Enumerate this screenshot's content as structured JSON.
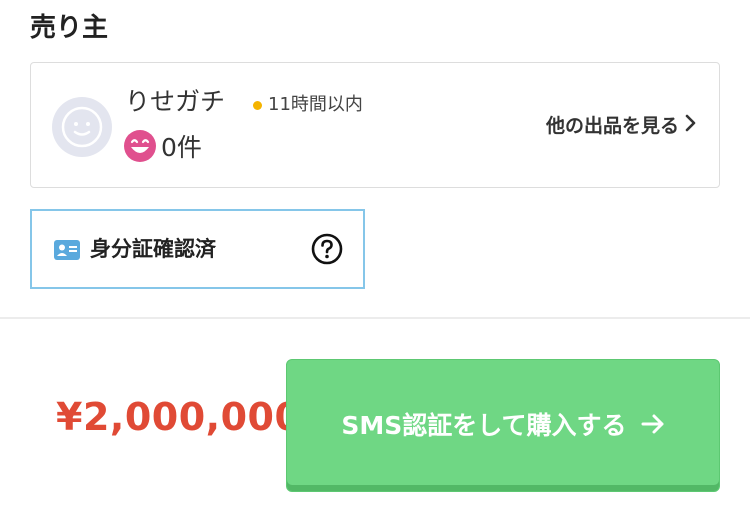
{
  "section": {
    "title": "売り主"
  },
  "seller": {
    "name": "りせガチ",
    "activity": "11時間以内",
    "rating_count": "0件",
    "more_link": "他の出品を見る"
  },
  "verification": {
    "label": "身分証確認済"
  },
  "purchase": {
    "price": "¥2,000,000",
    "button_label": "SMS認証をして購入する"
  },
  "colors": {
    "price": "#e04a35",
    "button": "#6fd784",
    "badge_border": "#85c6e9",
    "activity_dot": "#f5b400",
    "rating_icon": "#e0508e"
  },
  "icons": {
    "avatar": "default-avatar-icon",
    "activity": "activity-dot-icon",
    "rating": "smile-face-icon",
    "more": "chevron-right-icon",
    "id": "id-card-icon",
    "help": "question-circle-icon",
    "buy": "arrow-right-icon"
  }
}
